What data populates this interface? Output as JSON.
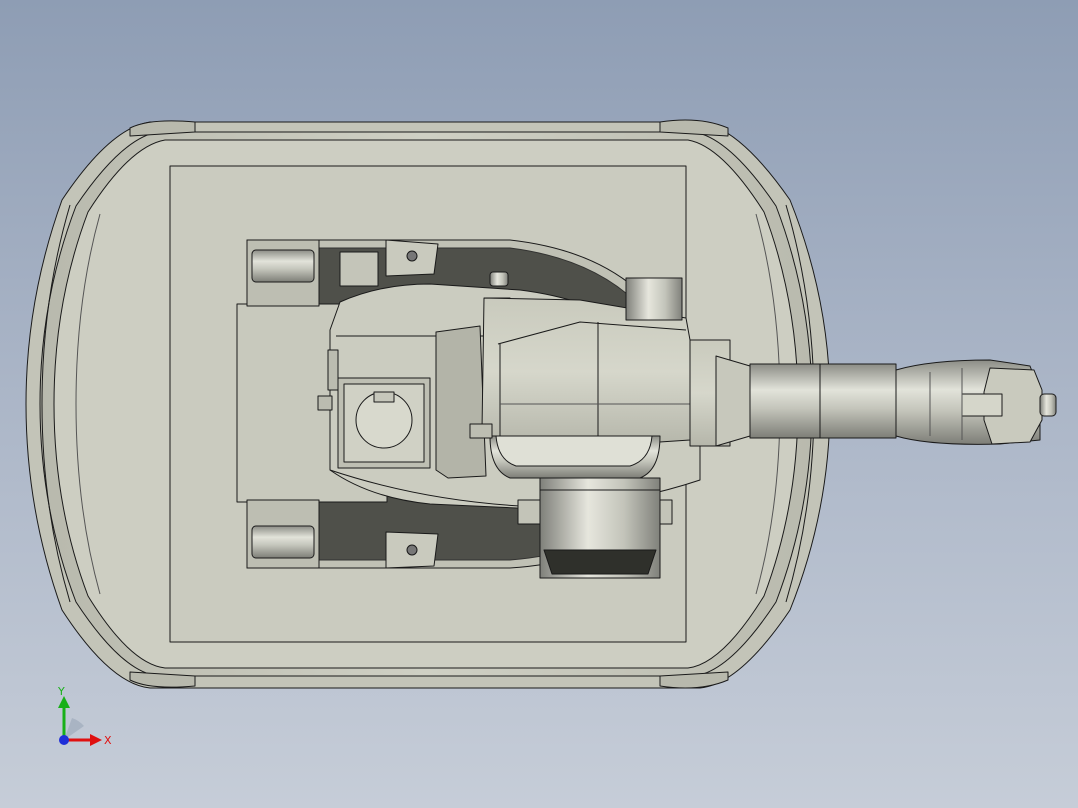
{
  "viewport": {
    "background_top": "#8e9db4",
    "background_bottom": "#c6cdd8"
  },
  "model": {
    "body_color": "#cdcdc0",
    "metal_color": "#b9bab0",
    "edge_color": "#1a1a1a"
  },
  "triad": {
    "x_label": "X",
    "y_label": "Y",
    "x_color": "#e01010",
    "y_color": "#18b018",
    "z_color": "#1f2fd8"
  }
}
